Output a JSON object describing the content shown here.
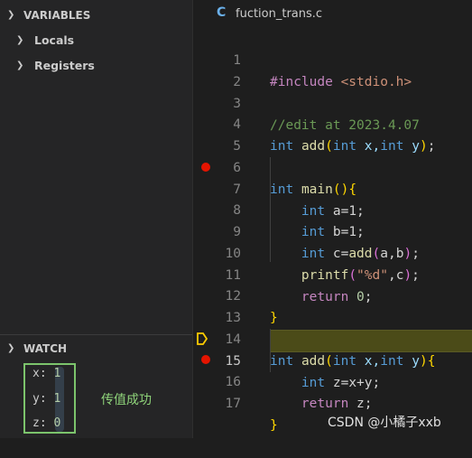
{
  "sidebar": {
    "variables_title": "VARIABLES",
    "locals_label": "Locals",
    "registers_label": "Registers",
    "watch_title": "WATCH",
    "watch": [
      {
        "name": "x:",
        "value": "1"
      },
      {
        "name": "y:",
        "value": "1"
      },
      {
        "name": "z:",
        "value": "0"
      }
    ],
    "annotation": "传值成功"
  },
  "editor": {
    "tab_icon": "C",
    "filename": "fuction_trans.c",
    "line_numbers": [
      "1",
      "2",
      "3",
      "4",
      "5",
      "6",
      "7",
      "8",
      "9",
      "10",
      "11",
      "12",
      "13",
      "14",
      "15",
      "16",
      "17"
    ],
    "current_line": "15",
    "breakpoint_lines": [
      "7",
      "16"
    ]
  },
  "code": {
    "l1": {
      "a": "#include",
      "b": " ",
      "c": "<stdio.h>"
    },
    "l3": {
      "a": "//edit at 2023.4.07"
    },
    "l4": {
      "a": "int",
      "b": " ",
      "c": "add",
      "d": "(",
      "e": "int",
      "f": " x,",
      "g": "int",
      "h": " y",
      "i": ")",
      "j": ";"
    },
    "l6": {
      "a": "int",
      "b": " ",
      "c": "main",
      "d": "()",
      "e": "{"
    },
    "l7": {
      "a": "    ",
      "b": "int",
      "c": " a=1;"
    },
    "l8": {
      "a": "    ",
      "b": "int",
      "c": " b=1;"
    },
    "l9": {
      "a": "    ",
      "b": "int",
      "c": " c=",
      "d": "add",
      "e": "(",
      "f": "a,b",
      "g": ")",
      "h": ";"
    },
    "l10": {
      "a": "    ",
      "b": "printf",
      "c": "(",
      "d": "\"%d\"",
      "e": ",c",
      "f": ")",
      "g": ";"
    },
    "l11": {
      "a": "    ",
      "b": "return",
      "c": " ",
      "d": "0",
      "e": ";"
    },
    "l12": {
      "a": "}"
    },
    "l14": {
      "a": "int",
      "b": " ",
      "c": "add",
      "d": "(",
      "e": "int",
      "f": " x,",
      "g": "int",
      "h": " y",
      "i": ")",
      "j": "{"
    },
    "l15": {
      "a": "    ",
      "b": "int",
      "c": " z=x+y;"
    },
    "l16": {
      "a": "    ",
      "b": "return",
      "c": " z;"
    },
    "l17": {
      "a": "}"
    }
  },
  "watermark": "CSDN @小橘子xxb",
  "colors": {
    "breakpoint": "#e51400",
    "current_line_highlight": "#4b4b18",
    "annotation_box": "#7cc46c"
  }
}
